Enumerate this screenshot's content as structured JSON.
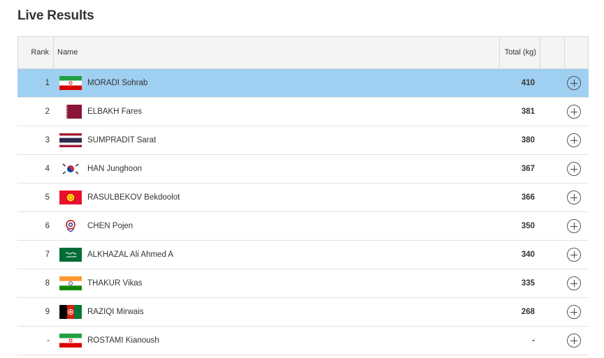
{
  "page": {
    "title": "Live Results"
  },
  "columns": {
    "rank": "Rank",
    "name": "Name",
    "total": "Total (kg)"
  },
  "rows": [
    {
      "rank": "1",
      "name": "MORADI Sohrab",
      "total": "410",
      "flag": "iran-flag",
      "highlighted": true
    },
    {
      "rank": "2",
      "name": "ELBAKH Fares",
      "total": "381",
      "flag": "qatar-flag"
    },
    {
      "rank": "3",
      "name": "SUMPRADIT Sarat",
      "total": "380",
      "flag": "thailand-flag"
    },
    {
      "rank": "4",
      "name": "HAN Junghoon",
      "total": "367",
      "flag": "korea-flag"
    },
    {
      "rank": "5",
      "name": "RASULBEKOV Bekdoolot",
      "total": "366",
      "flag": "kyrgyzstan-flag"
    },
    {
      "rank": "6",
      "name": "CHEN Pojen",
      "total": "350",
      "flag": "chinese-taipei-flag"
    },
    {
      "rank": "7",
      "name": "ALKHAZAL Ali Ahmed A",
      "total": "340",
      "flag": "saudi-arabia-flag"
    },
    {
      "rank": "8",
      "name": "THAKUR Vikas",
      "total": "335",
      "flag": "india-flag"
    },
    {
      "rank": "9",
      "name": "RAZIQI Mirwais",
      "total": "268",
      "flag": "afghanistan-flag"
    },
    {
      "rank": "-",
      "name": "ROSTAMI Kianoush",
      "total": "-",
      "flag": "iran-flag"
    }
  ],
  "colors": {
    "highlight": "#9fcff1",
    "header_bg": "#f4f4f4",
    "border": "#d8d8d8"
  }
}
